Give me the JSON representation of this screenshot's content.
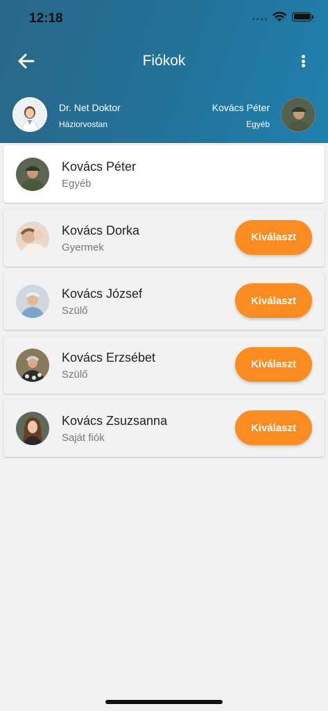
{
  "status_bar": {
    "time": "12:18"
  },
  "header": {
    "title": "Fiókok",
    "doctor": {
      "name": "Dr. Net Doktor",
      "role": "Háziorvostan",
      "avatar": "doctor-avatar"
    },
    "current_user": {
      "name": "Kovács Péter",
      "role": "Egyéb",
      "avatar": "man-cap-avatar"
    }
  },
  "accounts": [
    {
      "name": "Kovács Péter",
      "role": "Egyéb",
      "active": true,
      "button": ""
    },
    {
      "name": "Kovács Dorka",
      "role": "Gyermek",
      "active": false,
      "button": "Kiválaszt"
    },
    {
      "name": "Kovács József",
      "role": "Szülő",
      "active": false,
      "button": "Kiválaszt"
    },
    {
      "name": "Kovács Erzsébet",
      "role": "Szülő",
      "active": false,
      "button": "Kiválaszt"
    },
    {
      "name": "Kovács Zsuzsanna",
      "role": "Saját fiók",
      "active": false,
      "button": "Kiválaszt"
    }
  ],
  "colors": {
    "header_start": "#2a6788",
    "header_end": "#1f80ad",
    "accent": "#fb8c22",
    "background": "#f2f2f2"
  }
}
